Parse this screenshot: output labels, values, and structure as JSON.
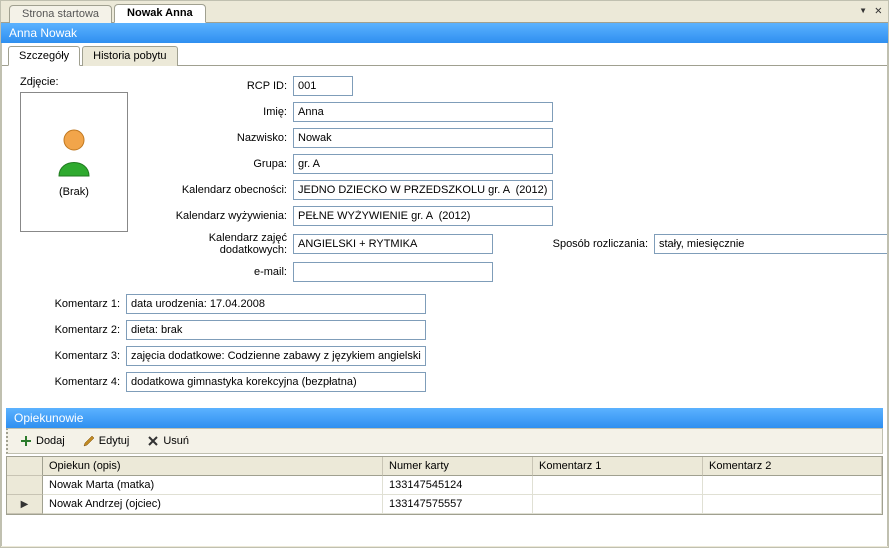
{
  "tabs": {
    "start": "Strona startowa",
    "person": "Nowak Anna"
  },
  "titleBar": "Anna Nowak",
  "subtabs": {
    "details": "Szczegóły",
    "history": "Historia pobytu"
  },
  "photo": {
    "label": "Zdjęcie:",
    "placeholder": "(Brak)"
  },
  "fields": {
    "rcp_label": "RCP ID:",
    "rcp_value": "001",
    "first_label": "Imię:",
    "first_value": "Anna",
    "last_label": "Nazwisko:",
    "last_value": "Nowak",
    "group_label": "Grupa:",
    "group_value": "gr. A",
    "attendance_label": "Kalendarz obecności:",
    "attendance_value": "JEDNO DZIECKO W PRZEDSZKOLU gr. A  (2012)",
    "meals_label": "Kalendarz wyżywienia:",
    "meals_value": "PEŁNE WYŻYWIENIE gr. A  (2012)",
    "extras_label": "Kalendarz zajęć dodatkowych:",
    "extras_value": "ANGIELSKI + RYTMIKA",
    "settlement_label": "Sposób rozliczania:",
    "settlement_value": "stały, miesięcznie",
    "email_label": "e-mail:",
    "email_value": ""
  },
  "comments": {
    "c1_label": "Komentarz 1:",
    "c1_value": "data urodzenia: 17.04.2008",
    "c2_label": "Komentarz 2:",
    "c2_value": "dieta: brak",
    "c3_label": "Komentarz 3:",
    "c3_value": "zajęcia dodatkowe: Codzienne zabawy z językiem angielskim",
    "c4_label": "Komentarz 4:",
    "c4_value": "dodatkowa gimnastyka korekcyjna (bezpłatna)"
  },
  "guardians": {
    "section_title": "Opiekunowie",
    "toolbar": {
      "add": "Dodaj",
      "edit": "Edytuj",
      "delete": "Usuń"
    },
    "columns": {
      "opiekun": "Opiekun (opis)",
      "numer": "Numer karty",
      "k1": "Komentarz 1",
      "k2": "Komentarz 2"
    },
    "rows": [
      {
        "opiekun": "Nowak Marta (matka)",
        "numer": "133147545124",
        "k1": "",
        "k2": ""
      },
      {
        "opiekun": "Nowak Andrzej (ojciec)",
        "numer": "133147575557",
        "k1": "",
        "k2": ""
      }
    ]
  }
}
